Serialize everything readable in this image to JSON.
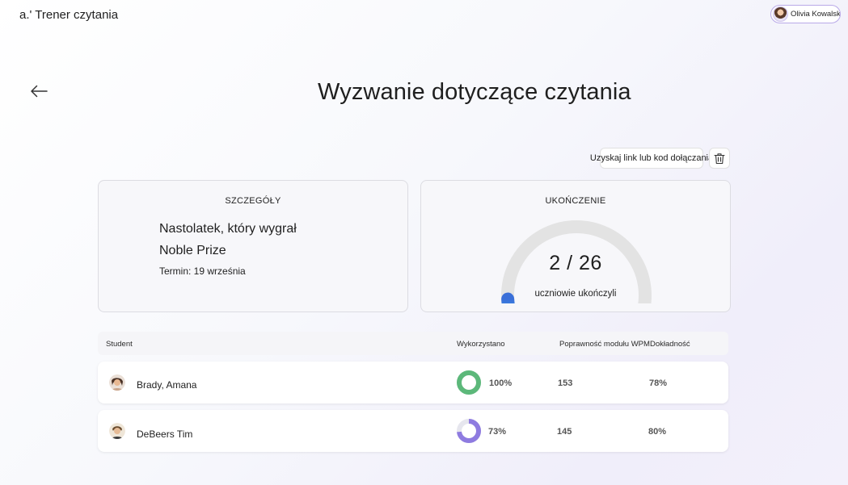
{
  "app": {
    "title": "a.' Trener czytania"
  },
  "user": {
    "name": "Olivia Kowalska"
  },
  "page": {
    "title": "Wyzwanie dotyczące czytania"
  },
  "actions": {
    "link_label": "Uzyskaj link lub kod dołączania"
  },
  "details": {
    "heading": "SZCZEGÓŁY",
    "title_line1": "Nastolatek, który wygrał",
    "title_line2": "Noble Prize",
    "due": "Termin: 19 września"
  },
  "completion": {
    "heading": "UKOŃCZENIE",
    "completed": 2,
    "total": 26,
    "value_text": "2 / 26",
    "caption": "uczniowie ukończyli"
  },
  "table": {
    "columns": [
      "Student",
      "Wykorzystano",
      "Poprawność modułu WPM",
      "Dokładność"
    ],
    "rows": [
      {
        "name": "Brady, Amana",
        "used": "100%",
        "used_fraction": 1.0,
        "wpm": "153",
        "accuracy": "78%",
        "ring_color": "#5cb87a"
      },
      {
        "name": "DeBeers Tim",
        "used": "73%",
        "used_fraction": 0.73,
        "wpm": "145",
        "accuracy": "80%",
        "ring_color": "#8e7be0"
      }
    ]
  },
  "colors": {
    "accent": "#3a86e0",
    "track": "#e3e3e3"
  }
}
